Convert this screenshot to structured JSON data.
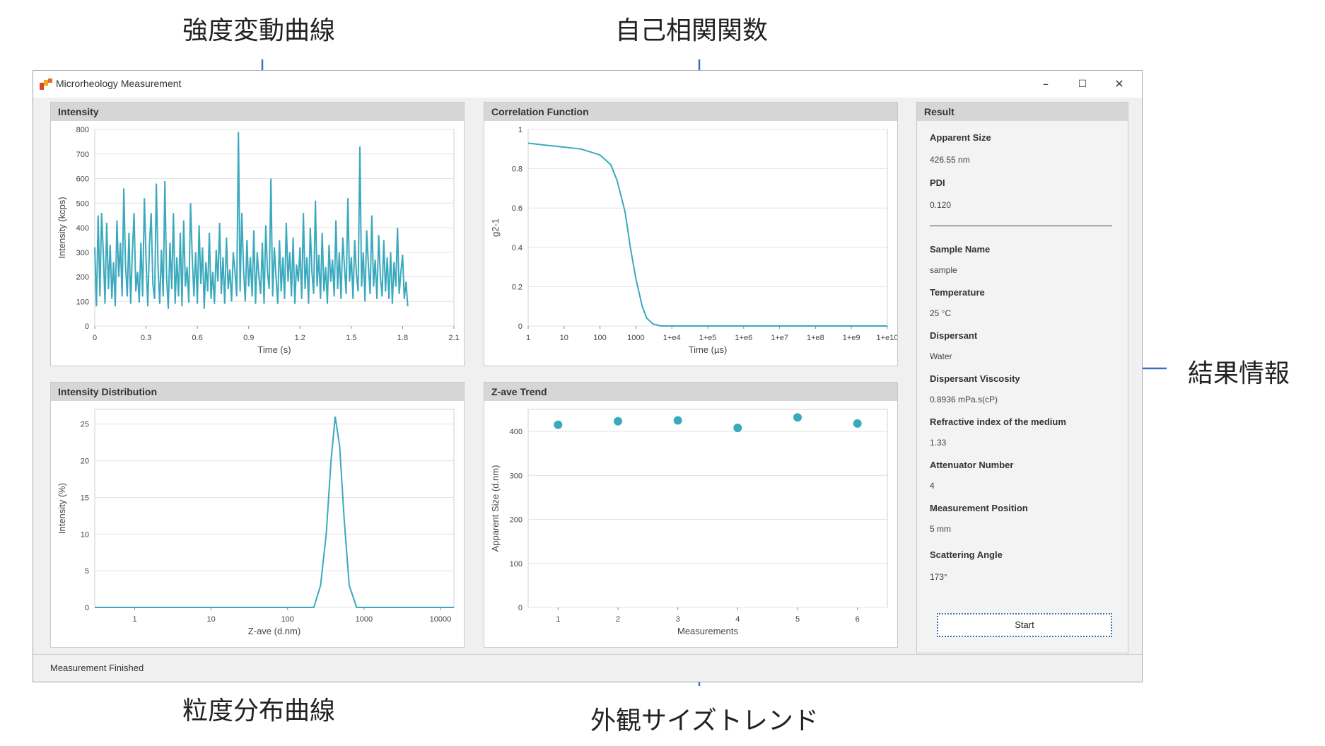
{
  "annotations": {
    "intensity_curve": "強度変動曲線",
    "autocorrelation": "自己相関関数",
    "result_info": "結果情報",
    "size_distribution": "粒度分布曲線",
    "apparent_size_trend": "外観サイズトレンド"
  },
  "window": {
    "title": "Microrheology Measurement",
    "minimize": "–",
    "maximize": "☐",
    "close": "✕"
  },
  "panels": {
    "intensity": "Intensity",
    "correlation": "Correlation Function",
    "distribution": "Intensity Distribution",
    "zave": "Z-ave Trend",
    "result": "Result"
  },
  "result": {
    "apparent_size_label": "Apparent Size",
    "apparent_size_value": "426.55 nm",
    "pdi_label": "PDI",
    "pdi_value": "0.120",
    "sample_name_label": "Sample Name",
    "sample_name_value": "sample",
    "temperature_label": "Temperature",
    "temperature_value": "25 °C",
    "dispersant_label": "Dispersant",
    "dispersant_value": "Water",
    "viscosity_label": "Dispersant Viscosity",
    "viscosity_value": "0.8936 mPa.s(cP)",
    "refractive_label": "Refractive index of the medium",
    "refractive_value": "1.33",
    "attenuator_label": "Attenuator Number",
    "attenuator_value": "4",
    "position_label": "Measurement Position",
    "position_value": "5 mm",
    "angle_label": "Scattering Angle",
    "angle_value": "173°",
    "start_button": "Start"
  },
  "status": "Measurement Finished",
  "chart_data": [
    {
      "type": "line",
      "name": "intensity",
      "xlabel": "Time (s)",
      "ylabel": "Intensity (kcps)",
      "xlim": [
        0,
        2.1
      ],
      "ylim": [
        0,
        800
      ],
      "xticks": [
        "0",
        "0.3",
        "0.6",
        "0.9",
        "1.2",
        "1.5",
        "1.8",
        "2.1"
      ],
      "yticks": [
        "0",
        "100",
        "200",
        "300",
        "400",
        "500",
        "600",
        "700",
        "800"
      ],
      "color": "#3aa9bd",
      "x": [
        0.0,
        0.01,
        0.02,
        0.03,
        0.04,
        0.05,
        0.06,
        0.07,
        0.08,
        0.09,
        0.1,
        0.11,
        0.12,
        0.13,
        0.14,
        0.15,
        0.16,
        0.17,
        0.18,
        0.19,
        0.2,
        0.21,
        0.22,
        0.23,
        0.24,
        0.25,
        0.26,
        0.27,
        0.28,
        0.29,
        0.3,
        0.31,
        0.32,
        0.33,
        0.34,
        0.35,
        0.36,
        0.37,
        0.38,
        0.39,
        0.4,
        0.41,
        0.42,
        0.43,
        0.44,
        0.45,
        0.46,
        0.47,
        0.48,
        0.49,
        0.5,
        0.51,
        0.52,
        0.53,
        0.54,
        0.55,
        0.56,
        0.57,
        0.58,
        0.59,
        0.6,
        0.61,
        0.62,
        0.63,
        0.64,
        0.65,
        0.66,
        0.67,
        0.68,
        0.69,
        0.7,
        0.71,
        0.72,
        0.73,
        0.74,
        0.75,
        0.76,
        0.77,
        0.78,
        0.79,
        0.8,
        0.81,
        0.82,
        0.83,
        0.84,
        0.85,
        0.86,
        0.87,
        0.88,
        0.89,
        0.9,
        0.91,
        0.92,
        0.93,
        0.94,
        0.95,
        0.96,
        0.97,
        0.98,
        0.99,
        1.0,
        1.01,
        1.02,
        1.03,
        1.04,
        1.05,
        1.06,
        1.07,
        1.08,
        1.09,
        1.1,
        1.11,
        1.12,
        1.13,
        1.14,
        1.15,
        1.16,
        1.17,
        1.18,
        1.19,
        1.2,
        1.21,
        1.22,
        1.23,
        1.24,
        1.25,
        1.26,
        1.27,
        1.28,
        1.29,
        1.3,
        1.31,
        1.32,
        1.33,
        1.34,
        1.35,
        1.36,
        1.37,
        1.38,
        1.39,
        1.4,
        1.41,
        1.42,
        1.43,
        1.44,
        1.45,
        1.46,
        1.47,
        1.48,
        1.49,
        1.5,
        1.51,
        1.52,
        1.53,
        1.54,
        1.55,
        1.56,
        1.57,
        1.58,
        1.59,
        1.6,
        1.61,
        1.62,
        1.63,
        1.64,
        1.65,
        1.66,
        1.67,
        1.68,
        1.69,
        1.7,
        1.71,
        1.72,
        1.73,
        1.74,
        1.75,
        1.76,
        1.77,
        1.78,
        1.79,
        1.8,
        1.81,
        1.82,
        1.83,
        1.84,
        1.85,
        1.86,
        1.87,
        1.88,
        1.89,
        1.9,
        1.91,
        1.92,
        1.93,
        1.94,
        1.95,
        1.96,
        1.97,
        1.98,
        1.99,
        2.0,
        2.01,
        2.02,
        2.03,
        2.04,
        2.05,
        2.06,
        2.07,
        2.08,
        2.09,
        2.1
      ],
      "y": [
        320,
        80,
        450,
        120,
        460,
        300,
        90,
        420,
        150,
        330,
        110,
        260,
        80,
        430,
        200,
        340,
        120,
        560,
        250,
        120,
        380,
        90,
        300,
        460,
        140,
        220,
        95,
        340,
        120,
        520,
        270,
        80,
        330,
        460,
        170,
        110,
        580,
        240,
        90,
        310,
        120,
        590,
        200,
        70,
        340,
        150,
        460,
        90,
        280,
        120,
        380,
        80,
        430,
        160,
        240,
        95,
        500,
        280,
        120,
        300,
        90,
        410,
        170,
        320,
        70,
        260,
        140,
        380,
        110,
        220,
        90,
        310,
        180,
        420,
        130,
        280,
        90,
        360,
        150,
        230,
        100,
        300,
        220,
        120,
        790,
        140,
        460,
        230,
        100,
        350,
        160,
        280,
        120,
        390,
        90,
        300,
        200,
        130,
        340,
        90,
        410,
        220,
        150,
        600,
        120,
        320,
        200,
        90,
        350,
        140,
        280,
        110,
        420,
        180,
        300,
        120,
        360,
        90,
        250,
        180,
        320,
        110,
        460,
        150,
        280,
        90,
        400,
        220,
        130,
        510,
        160,
        290,
        110,
        380,
        140,
        240,
        90,
        330,
        180,
        270,
        120,
        430,
        150,
        300,
        110,
        360,
        240,
        130,
        520,
        180,
        280,
        110,
        350,
        210,
        140,
        730,
        160,
        300,
        100,
        390,
        250,
        130,
        450,
        160,
        270,
        110,
        370,
        200,
        120,
        350,
        140,
        280,
        110,
        300,
        90,
        260,
        160,
        400,
        130,
        220,
        290,
        110,
        180,
        80
      ],
      "points": 212
    },
    {
      "type": "line",
      "name": "correlation",
      "xlabel": "Time (µs)",
      "ylabel": "g2-1",
      "xscale": "log",
      "xlim": [
        1,
        10000000000
      ],
      "ylim": [
        0,
        1
      ],
      "xticks": [
        "1",
        "10",
        "100",
        "1000",
        "1+e4",
        "1+e5",
        "1+e6",
        "1+e7",
        "1+e8",
        "1+e9",
        "1+e10"
      ],
      "yticks": [
        "0",
        "0.2",
        "0.4",
        "0.6",
        "0.8",
        "1"
      ],
      "color": "#3aa9bd",
      "x": [
        1,
        3,
        10,
        30,
        100,
        200,
        300,
        500,
        700,
        1000,
        1500,
        2000,
        3000,
        5000,
        10000,
        100000,
        1000000,
        10000000,
        100000000,
        1000000000,
        10000000000
      ],
      "y": [
        0.93,
        0.92,
        0.91,
        0.9,
        0.87,
        0.82,
        0.74,
        0.58,
        0.4,
        0.24,
        0.1,
        0.04,
        0.01,
        0.0,
        0.0,
        0.0,
        0.0,
        0.0,
        0.0,
        0.0,
        0.0
      ]
    },
    {
      "type": "line",
      "name": "distribution",
      "xlabel": "Z-ave (d.nm)",
      "ylabel": "Intensity (%)",
      "xscale": "log",
      "xlim": [
        0.3,
        15000
      ],
      "ylim": [
        0,
        27
      ],
      "xticks": [
        "1",
        "10",
        "100",
        "1000",
        "10000"
      ],
      "yticks": [
        "0",
        "5",
        "10",
        "15",
        "20",
        "25"
      ],
      "color": "#3aa9bd",
      "x": [
        0.3,
        1,
        10,
        100,
        220,
        270,
        320,
        370,
        420,
        480,
        550,
        640,
        800,
        1000,
        10000,
        15000
      ],
      "y": [
        0,
        0,
        0,
        0,
        0,
        3,
        10,
        20,
        26,
        22,
        12,
        3,
        0,
        0,
        0,
        0
      ]
    },
    {
      "type": "scatter",
      "name": "zave",
      "xlabel": "Measurements",
      "ylabel": "Apparent Size (d.nm)",
      "xlim": [
        0.5,
        6.5
      ],
      "ylim": [
        0,
        450
      ],
      "xticks": [
        "1",
        "2",
        "3",
        "4",
        "5",
        "6"
      ],
      "yticks": [
        "0",
        "100",
        "200",
        "300",
        "400"
      ],
      "color": "#3aa9bd",
      "x": [
        1,
        2,
        3,
        4,
        5,
        6
      ],
      "y": [
        415,
        423,
        425,
        408,
        432,
        418
      ]
    }
  ]
}
